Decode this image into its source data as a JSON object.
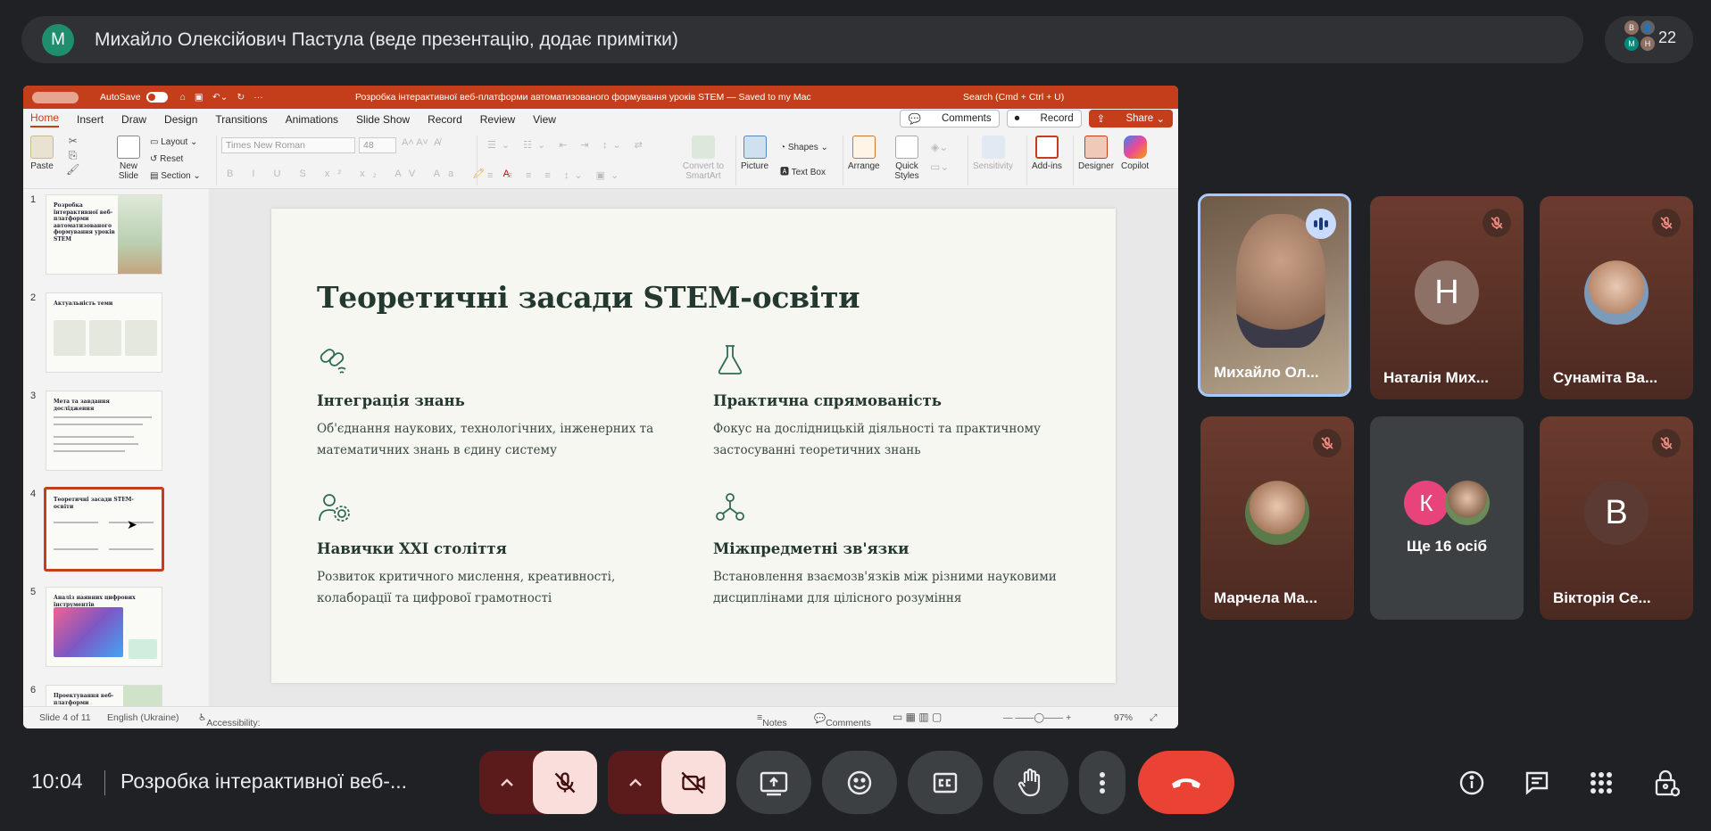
{
  "presenter": {
    "initial": "M",
    "label": "Михайло Олексійович Пастула (веде презентацію, додає примітки)"
  },
  "participants": {
    "count": "22",
    "mini_avatars": [
      "B",
      "M",
      "H"
    ]
  },
  "ppt": {
    "autosave": "AutoSave",
    "doc_title": "Розробка інтерактивної веб-платформи автоматизованого формування уроків STEM — Saved to my Mac",
    "search": "Search (Cmd + Ctrl + U)",
    "tabs": [
      "Home",
      "Insert",
      "Draw",
      "Design",
      "Transitions",
      "Animations",
      "Slide Show",
      "Record",
      "Review",
      "View"
    ],
    "comments_btn": "Comments",
    "record_btn": "Record",
    "share_btn": "Share",
    "ribbon": {
      "paste": "Paste",
      "new_slide": "New Slide",
      "layout": "Layout",
      "reset": "Reset",
      "section": "Section",
      "font": "Times New Roman",
      "size": "48",
      "convert": "Convert to SmartArt",
      "picture": "Picture",
      "shapes": "Shapes",
      "textbox": "Text Box",
      "arrange": "Arrange",
      "quick_styles": "Quick Styles",
      "sensitivity": "Sensitivity",
      "addins": "Add-ins",
      "designer": "Designer",
      "copilot": "Copilot"
    },
    "thumbnails": [
      {
        "num": "1",
        "title": "Розробка інтерактивної веб-платформи автоматизованого формування уроків STEM"
      },
      {
        "num": "2",
        "title": "Актуальність теми"
      },
      {
        "num": "3",
        "title": "Мета та завдання дослідження"
      },
      {
        "num": "4",
        "title": "Теоретичні засади STEM-освіти"
      },
      {
        "num": "5",
        "title": "Аналіз наявних цифрових інструментів"
      },
      {
        "num": "6",
        "title": "Проектування веб-платформи"
      }
    ],
    "slide": {
      "title": "Теоретичні засади STEM-освіти",
      "features": [
        {
          "icon": "integration-icon",
          "heading": "Інтеграція знань",
          "body": "Об'єднання наукових, технологічних, інженерних та математичних знань в єдину систему"
        },
        {
          "icon": "flask-icon",
          "heading": "Практична спрямованість",
          "body": "Фокус на дослідницькій діяльності та практичному застосуванні теоретичних знань"
        },
        {
          "icon": "person-gear-icon",
          "heading": "Навички XXI століття",
          "body": "Розвиток критичного мислення, креативності, колаборації та цифрової грамотності"
        },
        {
          "icon": "network-icon",
          "heading": "Міжпредметні зв'язки",
          "body": "Встановлення взаємозв'язків між різними науковими дисциплінами для цілісного розуміння"
        }
      ]
    },
    "status": {
      "slide": "Slide 4 of 11",
      "lang": "English (Ukraine)",
      "accessibility": "Accessibility: Investigate",
      "notes": "Notes",
      "comments": "Comments",
      "zoom": "97%"
    }
  },
  "tiles": [
    {
      "name": "Михайло Ол...",
      "speaking": true
    },
    {
      "name": "Наталія Мих...",
      "initial": "Н",
      "muted": true
    },
    {
      "name": "Сунаміта Ва...",
      "muted": true
    },
    {
      "name": "Марчела Ма...",
      "muted": true
    },
    {
      "name": "Ще 16 осіб",
      "initial": "К"
    },
    {
      "name": "Вікторія Се...",
      "initial": "В",
      "muted": true
    }
  ],
  "bottom": {
    "time": "10:04",
    "meeting_title": "Розробка інтерактивної веб-..."
  },
  "colors": {
    "accent_red": "#ea4335",
    "ppt_red": "#c43e1c",
    "slide_green": "#2e6b55",
    "bg": "#202124"
  }
}
